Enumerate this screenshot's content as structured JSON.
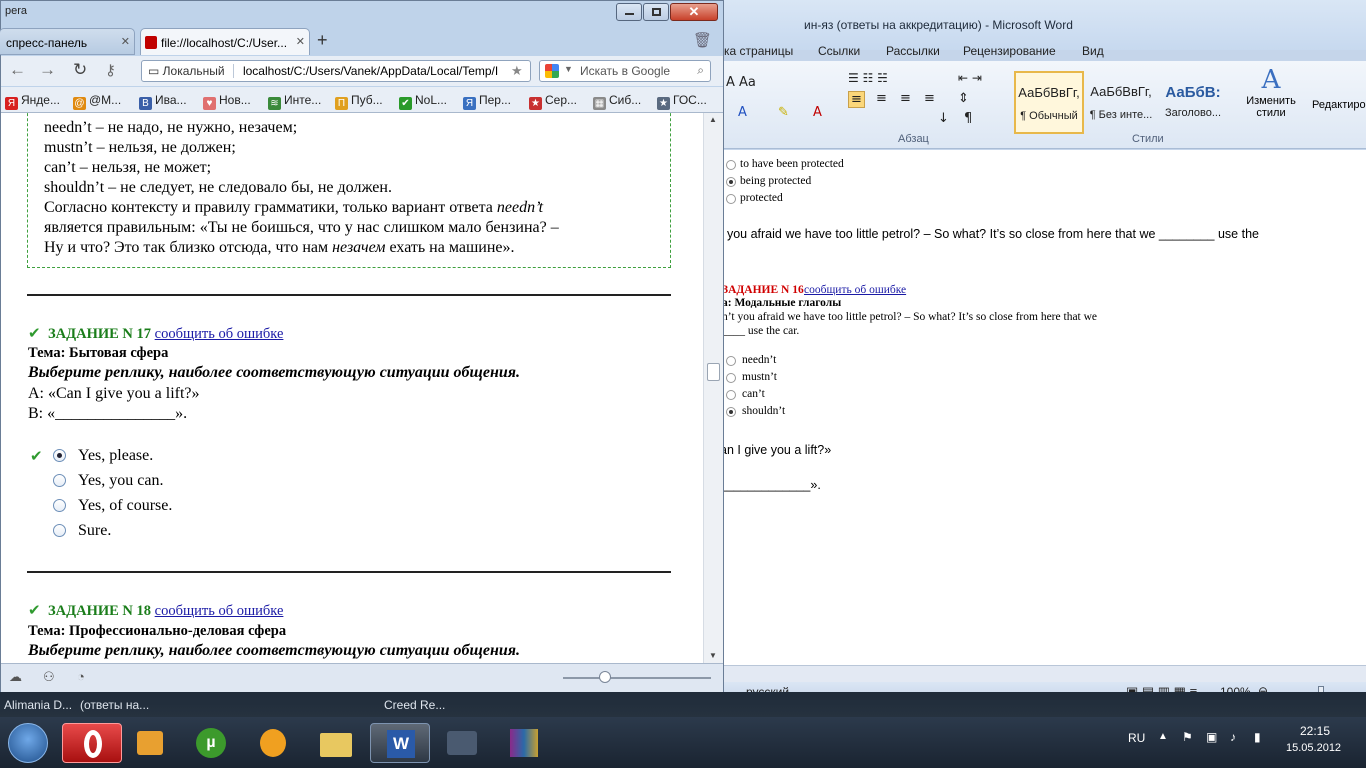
{
  "word": {
    "title": "ин-яз (ответы на аккредитацию)  -  Microsoft Word",
    "tabs": [
      "ка страницы",
      "Ссылки",
      "Рассылки",
      "Рецензирование",
      "Вид"
    ],
    "styles": [
      {
        "sample": "АаБбВвГг,",
        "name": "¶ Обычный"
      },
      {
        "sample": "АаБбВвГг,",
        "name": "¶ Без инте..."
      },
      {
        "sample": "АаБбВ:",
        "name": "Заголово..."
      }
    ],
    "change_styles": "Изменить стили",
    "editing": "Редактиро",
    "group_paragraph": "Абзац",
    "group_styles": "Стили",
    "doc": {
      "opt_a": "to have been protected",
      "opt_b": "being protected",
      "opt_c": "protected",
      "sentence": "t you afraid we have too little petrol? – So what? It’s so close from here that we ________ use the",
      "task_label": "ЗАДАНИЕ N 16",
      "task_link": "сообщить об ошибке",
      "topic": "а: Модальные глаголы",
      "q_line1": "n’t you afraid we have too little petrol? – So what? It’s so close from here that we",
      "q_line2": "____ use the car.",
      "answers": [
        "needn’t",
        "mustn’t",
        "can’t",
        "shouldn’t"
      ],
      "lift_line": "an I give you a lift?»",
      "blank_line": "_____________»."
    },
    "status_lang": "русский",
    "zoom": "100%"
  },
  "browser": {
    "tab1": "спресс-панель",
    "tab2": "file://localhost/C:/User...",
    "window_label": "pera",
    "local_label": "Локальный",
    "url": "localhost/C:/Users/Vanek/AppData/Local/Temp/I",
    "search_placeholder": "Искать в Google",
    "bookmarks": [
      "Янде...",
      "@M...",
      "Ива...",
      "Нов...",
      "Инте...",
      "Пуб...",
      "NoL...",
      "Пер...",
      "Сер...",
      "Сиб...",
      "ГОС..."
    ],
    "explanation": [
      "needn’t – не надо, не нужно, незачем;",
      "mustn’t – нельзя, не должен;",
      "can’t – нельзя, не может;",
      "shouldn’t – не следует, не следовало бы, не должен.",
      "Согласно контексту и правилу грамматики, только вариант ответа",
      "needn’t",
      "является правильным: «Ты не боишься, что у нас слишком мало бензина? –",
      "Ну и что? Это так близко отсюда, что нам",
      "незачем",
      "ехать на машине»."
    ],
    "task17": {
      "label": "ЗАДАНИЕ N 17",
      "link": "сообщить об ошибке",
      "topic": "Тема: Бытовая сфера",
      "instruction": "Выберите реплику, наиболее соответствующую ситуации общения.",
      "line_a": "A: «Can I give you a lift?»",
      "line_b": "B: «_______________».",
      "options": [
        "Yes, please.",
        "Yes, you can.",
        "Yes, of course.",
        "Sure."
      ]
    },
    "task18": {
      "label": "ЗАДАНИЕ N 18",
      "link": "сообщить об ошибке",
      "topic": "Тема: Профессионально-деловая сфера",
      "instruction": "Выберите реплику, наиболее соответствующую ситуации общения."
    }
  },
  "taskbar": {
    "item1": "Alimania D...",
    "item2": "(ответы на...",
    "item3": "Creed Re...",
    "lang": "RU",
    "time": "22:15",
    "date": "15.05.2012"
  }
}
